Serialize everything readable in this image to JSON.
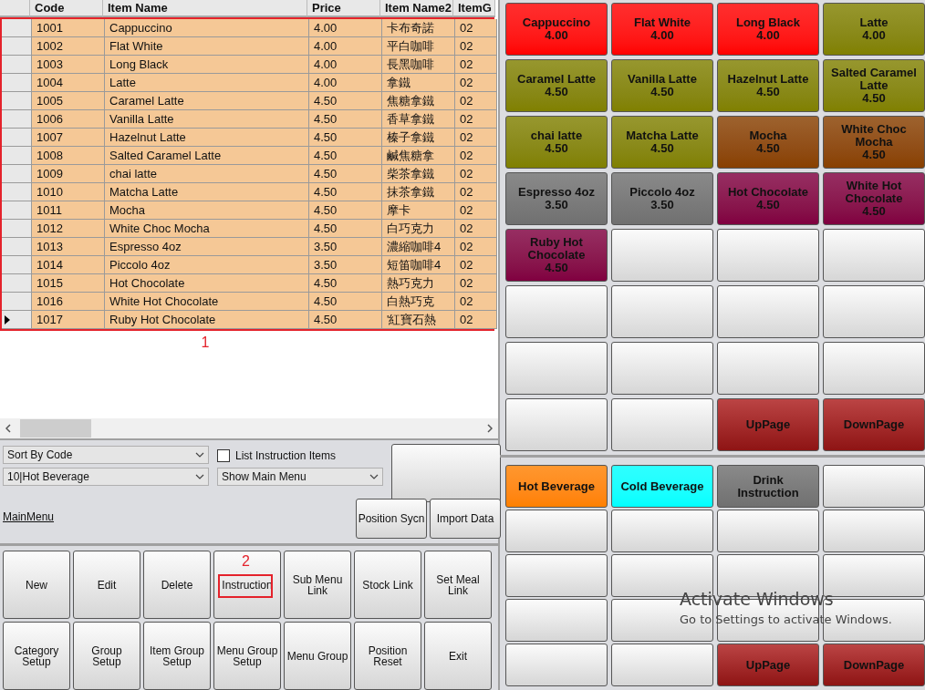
{
  "items_table": {
    "columns": [
      "Code",
      "Item Name",
      "Price",
      "Item Name2",
      "ItemG"
    ],
    "rows": [
      {
        "cells": [
          "1001",
          "Cappuccino",
          "4.00",
          "卡布奇諾",
          "02"
        ],
        "selected": false
      },
      {
        "cells": [
          "1002",
          "Flat White",
          "4.00",
          "平白咖啡",
          "02"
        ],
        "selected": false
      },
      {
        "cells": [
          "1003",
          "Long Black",
          "4.00",
          "長黑咖啡",
          "02"
        ],
        "selected": false
      },
      {
        "cells": [
          "1004",
          "Latte",
          "4.00",
          "拿鐵",
          "02"
        ],
        "selected": false
      },
      {
        "cells": [
          "1005",
          "Caramel Latte",
          "4.50",
          "焦糖拿鐵",
          "02"
        ],
        "selected": false
      },
      {
        "cells": [
          "1006",
          "Vanilla Latte",
          "4.50",
          "香草拿鐵",
          "02"
        ],
        "selected": false
      },
      {
        "cells": [
          "1007",
          "Hazelnut Latte",
          "4.50",
          "榛子拿鐵",
          "02"
        ],
        "selected": false
      },
      {
        "cells": [
          "1008",
          "Salted Caramel Latte",
          "4.50",
          "鹹焦糖拿",
          "02"
        ],
        "selected": false
      },
      {
        "cells": [
          "1009",
          "chai latte",
          "4.50",
          "柴茶拿鐵",
          "02"
        ],
        "selected": false
      },
      {
        "cells": [
          "1010",
          "Matcha Latte",
          "4.50",
          "抹茶拿鐵",
          "02"
        ],
        "selected": false
      },
      {
        "cells": [
          "1011",
          "Mocha",
          "4.50",
          "摩卡",
          "02"
        ],
        "selected": false
      },
      {
        "cells": [
          "1012",
          "White Choc Mocha",
          "4.50",
          "白巧克力",
          "02"
        ],
        "selected": false
      },
      {
        "cells": [
          "1013",
          "Espresso 4oz",
          "3.50",
          "濃縮咖啡4",
          "02"
        ],
        "selected": false
      },
      {
        "cells": [
          "1014",
          "Piccolo 4oz",
          "3.50",
          "短笛咖啡4",
          "02"
        ],
        "selected": false
      },
      {
        "cells": [
          "1015",
          "Hot Chocolate",
          "4.50",
          "熱巧克力",
          "02"
        ],
        "selected": false
      },
      {
        "cells": [
          "1016",
          "White Hot Chocolate",
          "4.50",
          "白熱巧克",
          "02"
        ],
        "selected": false
      },
      {
        "cells": [
          "1017",
          "Ruby Hot Chocolate",
          "4.50",
          "'紅寶石熱",
          "02"
        ],
        "selected": true
      }
    ],
    "annotation": "1"
  },
  "controls": {
    "sort_select": "Sort By Code",
    "list_instruction_items": {
      "label": "List Instruction Items",
      "checked": false
    },
    "category_select": "10|Hot Beverage",
    "menu_select": "Show Main Menu",
    "link": "MainMenu",
    "buttons": [
      "Position Sycn",
      "Import Data"
    ]
  },
  "action_buttons": [
    {
      "label": "New"
    },
    {
      "label": "Edit"
    },
    {
      "label": "Delete"
    },
    {
      "label": "Instruction",
      "annotation": "2"
    },
    {
      "label": "Sub Menu Link"
    },
    {
      "label": "Stock Link"
    },
    {
      "label": "Set Meal Link"
    },
    {
      "label": "Category Setup"
    },
    {
      "label": "Group Setup"
    },
    {
      "label": "Item Group Setup"
    },
    {
      "label": "Menu Group Setup"
    },
    {
      "label": "Menu Group"
    },
    {
      "label": "Position Reset"
    },
    {
      "label": "Exit"
    }
  ],
  "menu_items": [
    {
      "name": "Cappuccino",
      "price": "4.00",
      "color": "#ff0000"
    },
    {
      "name": "Flat White",
      "price": "4.00",
      "color": "#ff0000"
    },
    {
      "name": "Long Black",
      "price": "4.00",
      "color": "#ff0000"
    },
    {
      "name": "Latte",
      "price": "4.00",
      "color": "#808000"
    },
    {
      "name": "Caramel Latte",
      "price": "4.50",
      "color": "#808000"
    },
    {
      "name": "Vanilla Latte",
      "price": "4.50",
      "color": "#808000"
    },
    {
      "name": "Hazelnut Latte",
      "price": "4.50",
      "color": "#808000"
    },
    {
      "name": "Salted Caramel Latte",
      "price": "4.50",
      "color": "#808000"
    },
    {
      "name": "chai latte",
      "price": "4.50",
      "color": "#808000"
    },
    {
      "name": "Matcha Latte",
      "price": "4.50",
      "color": "#808000"
    },
    {
      "name": "Mocha",
      "price": "4.50",
      "color": "#884000"
    },
    {
      "name": "White Choc Mocha",
      "price": "4.50",
      "color": "#884000"
    },
    {
      "name": "Espresso 4oz",
      "price": "3.50",
      "color": "#707070"
    },
    {
      "name": "Piccolo 4oz",
      "price": "3.50",
      "color": "#707070"
    },
    {
      "name": "Hot Chocolate",
      "price": "4.50",
      "color": "#800040"
    },
    {
      "name": "White Hot Chocolate",
      "price": "4.50",
      "color": "#800040"
    },
    {
      "name": "Ruby Hot Chocolate",
      "price": "4.50",
      "color": "#800040"
    }
  ],
  "menu_pager": [
    "UpPage",
    "DownPage"
  ],
  "categories": [
    {
      "name": "Hot Beverage",
      "color": "#ff8000"
    },
    {
      "name": "Cold Beverage",
      "color": "#00ffff"
    },
    {
      "name": "Drink Instruction",
      "color": "#707070"
    }
  ],
  "category_pager": [
    "UpPage",
    "DownPage"
  ],
  "windows_watermark": {
    "title": "Activate Windows",
    "message": "Go to Settings to activate Windows."
  }
}
